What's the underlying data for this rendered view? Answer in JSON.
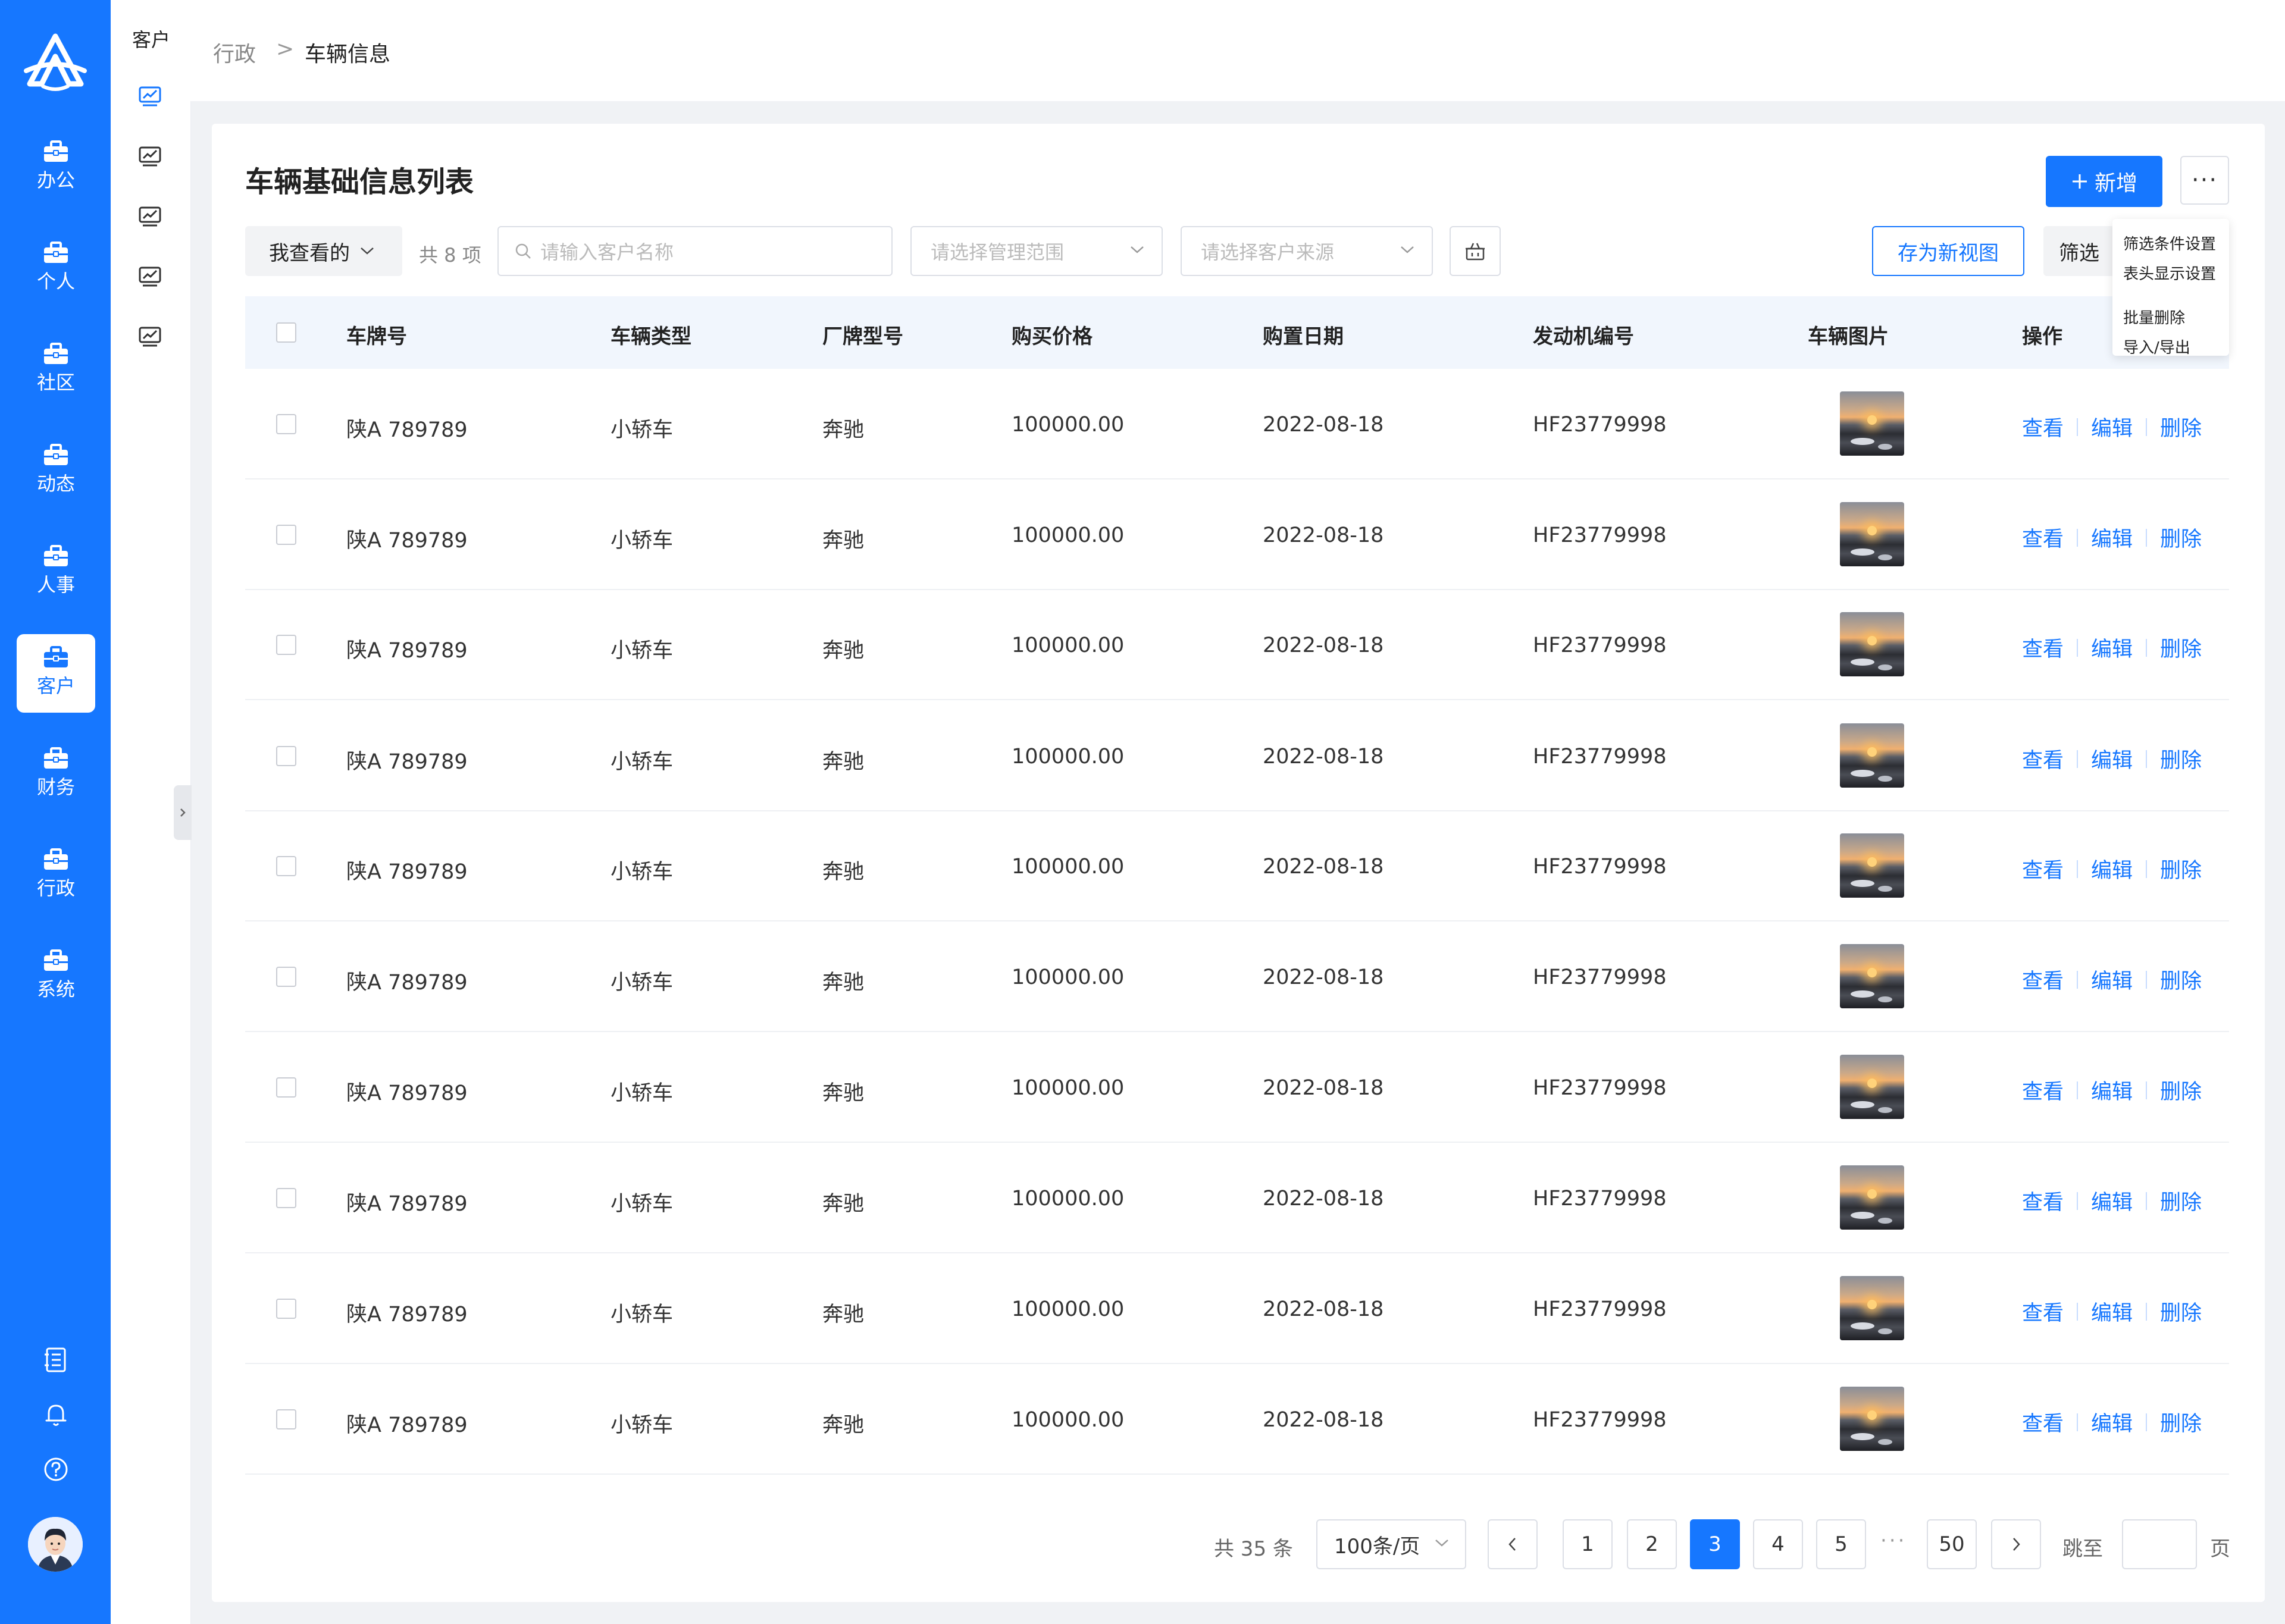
{
  "nav": {
    "items": [
      {
        "label": "办公",
        "icon": "briefcase-icon"
      },
      {
        "label": "个人",
        "icon": "briefcase-icon"
      },
      {
        "label": "社区",
        "icon": "briefcase-icon"
      },
      {
        "label": "动态",
        "icon": "briefcase-icon"
      },
      {
        "label": "人事",
        "icon": "briefcase-icon"
      },
      {
        "label": "客户",
        "icon": "briefcase-icon",
        "active": true
      },
      {
        "label": "财务",
        "icon": "briefcase-icon"
      },
      {
        "label": "行政",
        "icon": "briefcase-icon"
      },
      {
        "label": "系统",
        "icon": "briefcase-icon"
      }
    ],
    "bottom_icons": [
      "notebook-icon",
      "bell-icon",
      "help-icon"
    ]
  },
  "subnav": {
    "title": "客户",
    "icons": [
      "chart-monitor-icon",
      "chart-monitor-icon",
      "chart-monitor-icon",
      "chart-monitor-icon",
      "chart-monitor-icon"
    ]
  },
  "breadcrumb": {
    "parent": "行政",
    "separator": ">",
    "current": "车辆信息"
  },
  "page": {
    "title": "车辆基础信息列表",
    "add_button": "新增",
    "more_button": "···",
    "more_menu": [
      "筛选条件设置",
      "表头显示设置",
      "批量删除",
      "导入/导出"
    ]
  },
  "toolbar": {
    "view_select": "我查看的",
    "count": "共 8 项",
    "search_placeholder": "请输入客户名称",
    "range_placeholder": "请选择管理范围",
    "source_placeholder": "请选择客户来源",
    "save_view": "存为新视图",
    "filter": "筛选"
  },
  "table": {
    "columns": [
      "车牌号",
      "车辆类型",
      "厂牌型号",
      "购买价格",
      "购置日期",
      "发动机编号",
      "车辆图片",
      "操作"
    ],
    "rows": [
      {
        "plate": "陕A 789789",
        "type": "小轿车",
        "brand": "奔驰",
        "price": "100000.00",
        "date": "2022-08-18",
        "engine": "HF23779998"
      },
      {
        "plate": "陕A 789789",
        "type": "小轿车",
        "brand": "奔驰",
        "price": "100000.00",
        "date": "2022-08-18",
        "engine": "HF23779998"
      },
      {
        "plate": "陕A 789789",
        "type": "小轿车",
        "brand": "奔驰",
        "price": "100000.00",
        "date": "2022-08-18",
        "engine": "HF23779998"
      },
      {
        "plate": "陕A 789789",
        "type": "小轿车",
        "brand": "奔驰",
        "price": "100000.00",
        "date": "2022-08-18",
        "engine": "HF23779998"
      },
      {
        "plate": "陕A 789789",
        "type": "小轿车",
        "brand": "奔驰",
        "price": "100000.00",
        "date": "2022-08-18",
        "engine": "HF23779998"
      },
      {
        "plate": "陕A 789789",
        "type": "小轿车",
        "brand": "奔驰",
        "price": "100000.00",
        "date": "2022-08-18",
        "engine": "HF23779998"
      },
      {
        "plate": "陕A 789789",
        "type": "小轿车",
        "brand": "奔驰",
        "price": "100000.00",
        "date": "2022-08-18",
        "engine": "HF23779998"
      },
      {
        "plate": "陕A 789789",
        "type": "小轿车",
        "brand": "奔驰",
        "price": "100000.00",
        "date": "2022-08-18",
        "engine": "HF23779998"
      },
      {
        "plate": "陕A 789789",
        "type": "小轿车",
        "brand": "奔驰",
        "price": "100000.00",
        "date": "2022-08-18",
        "engine": "HF23779998"
      },
      {
        "plate": "陕A 789789",
        "type": "小轿车",
        "brand": "奔驰",
        "price": "100000.00",
        "date": "2022-08-18",
        "engine": "HF23779998"
      }
    ],
    "actions": {
      "view": "查看",
      "edit": "编辑",
      "delete": "删除"
    }
  },
  "pagination": {
    "total": "共 35 条",
    "page_size": "100条/页",
    "pages": [
      "1",
      "2",
      "3",
      "4",
      "5"
    ],
    "current": "3",
    "ellipsis": "···",
    "last": "50",
    "jump_label": "跳至",
    "page_label": "页"
  },
  "colors": {
    "primary": "#1677ff",
    "nav_bg": "#1677ff",
    "table_header_bg": "#f1f6fd"
  }
}
